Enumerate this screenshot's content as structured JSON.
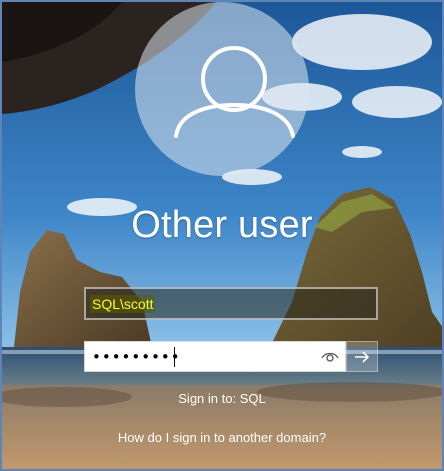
{
  "login": {
    "display_name": "Other user",
    "username_value": "SQL\\scott",
    "password_mask": "•••••••••",
    "sign_in_to": "Sign in to: SQL",
    "other_domain_link": "How do I sign in to another domain?"
  },
  "icons": {
    "avatar": "user-silhouette-icon",
    "reveal": "eye-icon",
    "submit": "arrow-right-icon"
  },
  "colors": {
    "username_highlight_text": "#f4ff2a",
    "username_highlight_bg": "#5c5c00",
    "sky_top": "#1e5b9c",
    "sand": "#b6906b"
  }
}
